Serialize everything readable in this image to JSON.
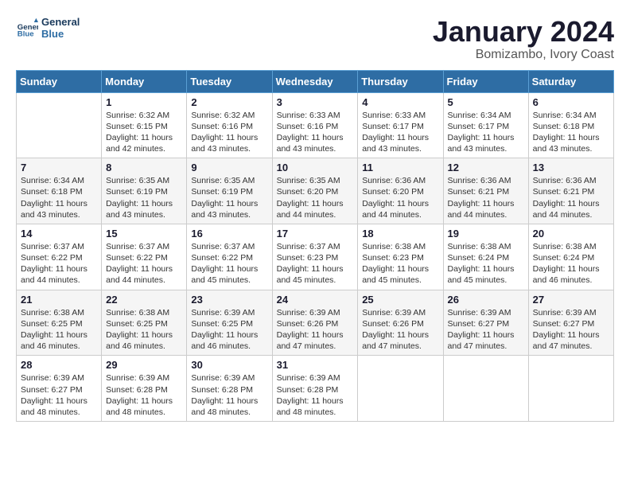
{
  "header": {
    "logo_line1": "General",
    "logo_line2": "Blue",
    "month_year": "January 2024",
    "location": "Bomizambo, Ivory Coast"
  },
  "weekdays": [
    "Sunday",
    "Monday",
    "Tuesday",
    "Wednesday",
    "Thursday",
    "Friday",
    "Saturday"
  ],
  "weeks": [
    [
      {
        "day": "",
        "info": ""
      },
      {
        "day": "1",
        "info": "Sunrise: 6:32 AM\nSunset: 6:15 PM\nDaylight: 11 hours\nand 42 minutes."
      },
      {
        "day": "2",
        "info": "Sunrise: 6:32 AM\nSunset: 6:16 PM\nDaylight: 11 hours\nand 43 minutes."
      },
      {
        "day": "3",
        "info": "Sunrise: 6:33 AM\nSunset: 6:16 PM\nDaylight: 11 hours\nand 43 minutes."
      },
      {
        "day": "4",
        "info": "Sunrise: 6:33 AM\nSunset: 6:17 PM\nDaylight: 11 hours\nand 43 minutes."
      },
      {
        "day": "5",
        "info": "Sunrise: 6:34 AM\nSunset: 6:17 PM\nDaylight: 11 hours\nand 43 minutes."
      },
      {
        "day": "6",
        "info": "Sunrise: 6:34 AM\nSunset: 6:18 PM\nDaylight: 11 hours\nand 43 minutes."
      }
    ],
    [
      {
        "day": "7",
        "info": "Sunrise: 6:34 AM\nSunset: 6:18 PM\nDaylight: 11 hours\nand 43 minutes."
      },
      {
        "day": "8",
        "info": "Sunrise: 6:35 AM\nSunset: 6:19 PM\nDaylight: 11 hours\nand 43 minutes."
      },
      {
        "day": "9",
        "info": "Sunrise: 6:35 AM\nSunset: 6:19 PM\nDaylight: 11 hours\nand 43 minutes."
      },
      {
        "day": "10",
        "info": "Sunrise: 6:35 AM\nSunset: 6:20 PM\nDaylight: 11 hours\nand 44 minutes."
      },
      {
        "day": "11",
        "info": "Sunrise: 6:36 AM\nSunset: 6:20 PM\nDaylight: 11 hours\nand 44 minutes."
      },
      {
        "day": "12",
        "info": "Sunrise: 6:36 AM\nSunset: 6:21 PM\nDaylight: 11 hours\nand 44 minutes."
      },
      {
        "day": "13",
        "info": "Sunrise: 6:36 AM\nSunset: 6:21 PM\nDaylight: 11 hours\nand 44 minutes."
      }
    ],
    [
      {
        "day": "14",
        "info": "Sunrise: 6:37 AM\nSunset: 6:22 PM\nDaylight: 11 hours\nand 44 minutes."
      },
      {
        "day": "15",
        "info": "Sunrise: 6:37 AM\nSunset: 6:22 PM\nDaylight: 11 hours\nand 44 minutes."
      },
      {
        "day": "16",
        "info": "Sunrise: 6:37 AM\nSunset: 6:22 PM\nDaylight: 11 hours\nand 45 minutes."
      },
      {
        "day": "17",
        "info": "Sunrise: 6:37 AM\nSunset: 6:23 PM\nDaylight: 11 hours\nand 45 minutes."
      },
      {
        "day": "18",
        "info": "Sunrise: 6:38 AM\nSunset: 6:23 PM\nDaylight: 11 hours\nand 45 minutes."
      },
      {
        "day": "19",
        "info": "Sunrise: 6:38 AM\nSunset: 6:24 PM\nDaylight: 11 hours\nand 45 minutes."
      },
      {
        "day": "20",
        "info": "Sunrise: 6:38 AM\nSunset: 6:24 PM\nDaylight: 11 hours\nand 46 minutes."
      }
    ],
    [
      {
        "day": "21",
        "info": "Sunrise: 6:38 AM\nSunset: 6:25 PM\nDaylight: 11 hours\nand 46 minutes."
      },
      {
        "day": "22",
        "info": "Sunrise: 6:38 AM\nSunset: 6:25 PM\nDaylight: 11 hours\nand 46 minutes."
      },
      {
        "day": "23",
        "info": "Sunrise: 6:39 AM\nSunset: 6:25 PM\nDaylight: 11 hours\nand 46 minutes."
      },
      {
        "day": "24",
        "info": "Sunrise: 6:39 AM\nSunset: 6:26 PM\nDaylight: 11 hours\nand 47 minutes."
      },
      {
        "day": "25",
        "info": "Sunrise: 6:39 AM\nSunset: 6:26 PM\nDaylight: 11 hours\nand 47 minutes."
      },
      {
        "day": "26",
        "info": "Sunrise: 6:39 AM\nSunset: 6:27 PM\nDaylight: 11 hours\nand 47 minutes."
      },
      {
        "day": "27",
        "info": "Sunrise: 6:39 AM\nSunset: 6:27 PM\nDaylight: 11 hours\nand 47 minutes."
      }
    ],
    [
      {
        "day": "28",
        "info": "Sunrise: 6:39 AM\nSunset: 6:27 PM\nDaylight: 11 hours\nand 48 minutes."
      },
      {
        "day": "29",
        "info": "Sunrise: 6:39 AM\nSunset: 6:28 PM\nDaylight: 11 hours\nand 48 minutes."
      },
      {
        "day": "30",
        "info": "Sunrise: 6:39 AM\nSunset: 6:28 PM\nDaylight: 11 hours\nand 48 minutes."
      },
      {
        "day": "31",
        "info": "Sunrise: 6:39 AM\nSunset: 6:28 PM\nDaylight: 11 hours\nand 48 minutes."
      },
      {
        "day": "",
        "info": ""
      },
      {
        "day": "",
        "info": ""
      },
      {
        "day": "",
        "info": ""
      }
    ]
  ]
}
